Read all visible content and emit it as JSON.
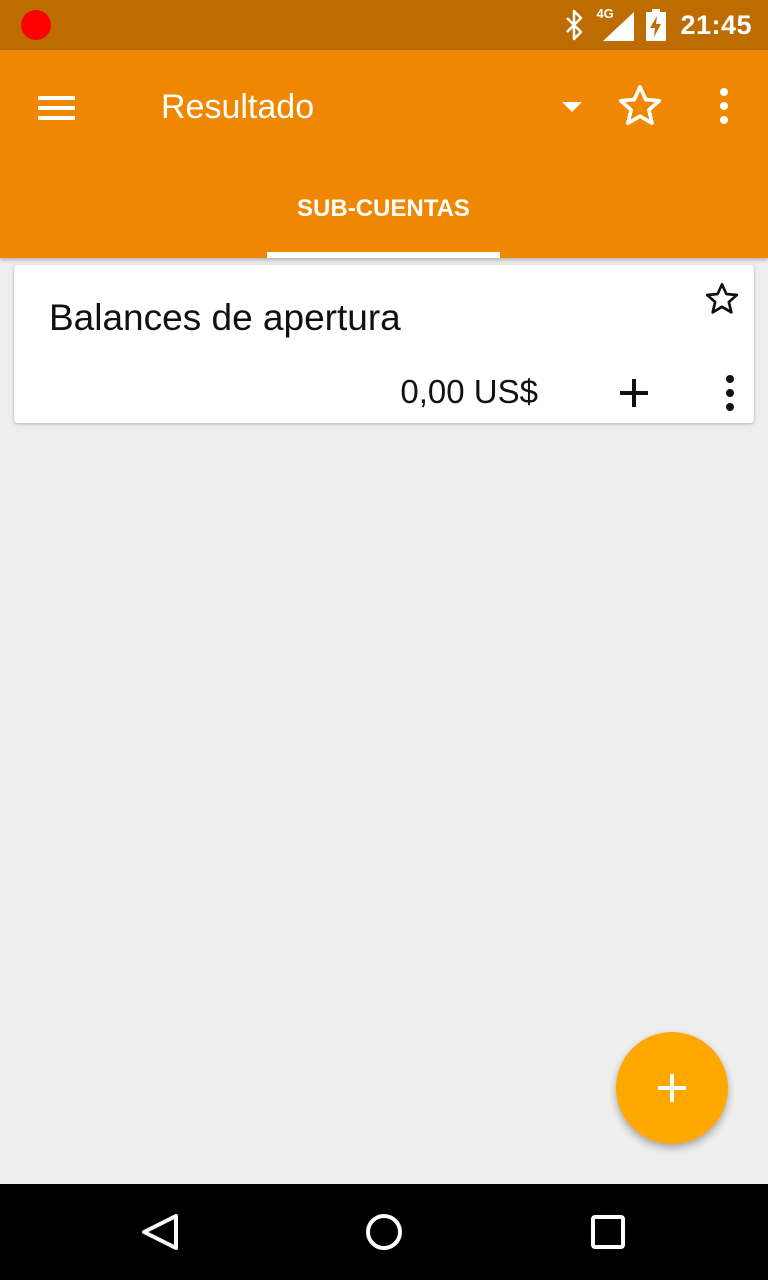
{
  "status_bar": {
    "network": "4G",
    "time": "21:45",
    "icons": [
      "recording-dot",
      "bluetooth-icon",
      "signal-icon",
      "battery-icon"
    ]
  },
  "toolbar": {
    "title": "Resultado",
    "icons": [
      "menu-icon",
      "dropdown-icon",
      "star-icon",
      "overflow-menu-icon"
    ]
  },
  "tabs": [
    {
      "label": "SUB-CUENTAS",
      "selected": true
    }
  ],
  "accounts": [
    {
      "name": "Balances de apertura",
      "balance": "0,00 US$",
      "favorite": false
    }
  ],
  "fab": {
    "icon": "plus-icon"
  },
  "colors": {
    "status_bar": "#bd6c00",
    "toolbar": "#ef8800",
    "fab": "#ffa800",
    "background": "#eeeeee",
    "recording": "#ff0000"
  },
  "nav_bar": {
    "icons": [
      "back-icon",
      "home-icon",
      "recents-icon"
    ]
  }
}
